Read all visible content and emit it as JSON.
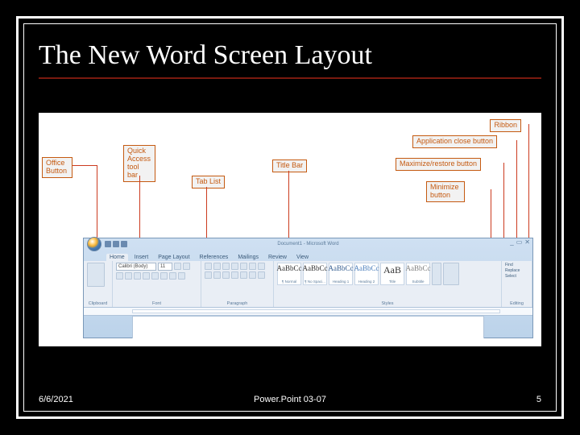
{
  "slide": {
    "title": "The New Word Screen Layout"
  },
  "labels": {
    "office_button": "Office\nButton",
    "quick_access": "Quick\nAccess\ntool bar",
    "tab_list": "Tab List",
    "title_bar": "Title Bar",
    "ribbon": "Ribbon",
    "app_close": "Application close button",
    "maximize": "Maximize/restore button",
    "minimize": "Minimize\nbutton"
  },
  "word": {
    "titlebar_text": "Document1 - Microsoft Word",
    "tabs": [
      "Home",
      "Insert",
      "Page Layout",
      "References",
      "Mailings",
      "Review",
      "View"
    ],
    "groups": {
      "clipboard": "Clipboard",
      "font": "Font",
      "paragraph": "Paragraph",
      "styles": "Styles",
      "editing": "Editing"
    },
    "font_name": "Calibri (Body)",
    "font_size": "11",
    "styles": [
      "¶ Normal",
      "¶ No Spaci...",
      "Heading 1",
      "Heading 2",
      "Title",
      "Subtitle"
    ],
    "style_sample": "AaBbCc",
    "style_sample_big": "AaB",
    "editing": {
      "find": "Find",
      "replace": "Replace",
      "select": "Select"
    }
  },
  "footer": {
    "date": "6/6/2021",
    "source": "Power.Point 03-07",
    "page": "5"
  }
}
